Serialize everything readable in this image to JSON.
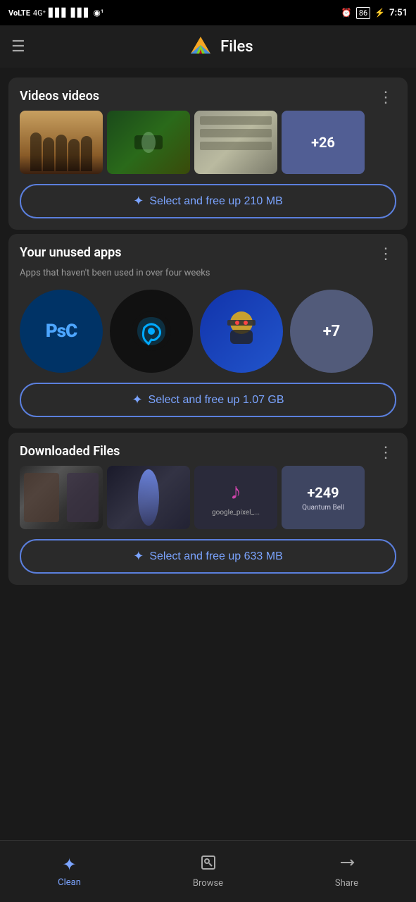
{
  "statusBar": {
    "leftIcons": "VoLTE 4G signal wifi location",
    "time": "7:51",
    "batteryLevel": "86",
    "alarm": true
  },
  "header": {
    "menuIcon": "☰",
    "appName": "Files",
    "logoColors": [
      "#f5a623",
      "#4a90d9",
      "#7ed321",
      "#d0021b"
    ]
  },
  "sections": {
    "videos": {
      "title": "Videos videos",
      "moreIcon": "⋮",
      "thumbnailCount": "+26",
      "selectButton": "Select and free up 210 MB"
    },
    "unusedApps": {
      "title": "Your unused apps",
      "subtitle": "Apps that haven't been used in over four weeks",
      "moreIcon": "⋮",
      "apps": [
        {
          "name": "Photoshop Camera",
          "label": "PsC"
        },
        {
          "name": "Quik",
          "label": "Q"
        },
        {
          "name": "Ninja Game",
          "label": ""
        },
        {
          "name": "More apps",
          "label": "+7"
        }
      ],
      "selectButton": "Select and free up 1.07 GB"
    },
    "downloadedFiles": {
      "title": "Downloaded Files",
      "moreIcon": "⋮",
      "files": [
        {
          "name": "couple photo",
          "type": "image"
        },
        {
          "name": "dark figure",
          "type": "image"
        },
        {
          "name": "google_pixel_...",
          "type": "audio"
        },
        {
          "name": "Quantum Bell",
          "label": "+249"
        }
      ],
      "selectButton": "Select and free up 633 MB"
    }
  },
  "bottomNav": {
    "items": [
      {
        "label": "Clean",
        "active": true
      },
      {
        "label": "Browse",
        "active": false
      },
      {
        "label": "Share",
        "active": false
      }
    ]
  },
  "icons": {
    "sparkle": "✦",
    "menu": "☰",
    "more": "⋮",
    "browse": "⊡",
    "share": "⇄",
    "music": "♪"
  }
}
